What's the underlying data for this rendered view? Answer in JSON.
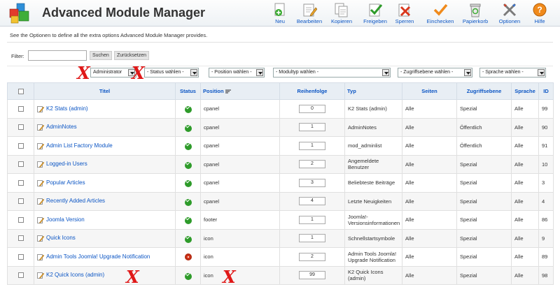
{
  "app": {
    "title": "Advanced Module Manager",
    "description": "See the Optionen to define all the extra options Advanced Module Manager provides."
  },
  "toolbar": [
    {
      "label": "Neu",
      "icon": "new-icon"
    },
    {
      "label": "Bearbeiten",
      "icon": "edit-icon"
    },
    {
      "label": "Kopieren",
      "icon": "copy-icon"
    },
    {
      "label": "Freigeben",
      "icon": "publish-icon"
    },
    {
      "label": "Sperren",
      "icon": "unpublish-icon"
    },
    {
      "label": "Einchecken",
      "icon": "checkin-icon"
    },
    {
      "label": "Papierkorb",
      "icon": "trash-icon"
    },
    {
      "label": "Optionen",
      "icon": "options-icon"
    },
    {
      "label": "Hilfe",
      "icon": "help-icon"
    }
  ],
  "filter": {
    "label": "Filter:",
    "value": "",
    "search_label": "Suchen",
    "reset_label": "Zurücksetzen"
  },
  "selects": {
    "client": "Administrator",
    "status": "- Status wählen -",
    "position": "- Position wählen -",
    "type": "- Modultyp wählen -",
    "access": "- Zugriffsebene wählen -",
    "language": "- Sprache wählen -"
  },
  "table": {
    "headers": {
      "title": "Titel",
      "status": "Status",
      "position": "Position",
      "ordering": "Reihenfolge",
      "type": "Typ",
      "pages": "Seiten",
      "access": "Zugriffsebene",
      "language": "Sprache",
      "id": "ID"
    },
    "rows": [
      {
        "title": "K2 Stats (admin)",
        "published": true,
        "position": "cpanel",
        "ordering": "0",
        "type": "K2 Stats (admin)",
        "pages": "Alle",
        "access": "Spezial",
        "language": "Alle",
        "id": "99"
      },
      {
        "title": "AdminNotes",
        "published": true,
        "position": "cpanel",
        "ordering": "1",
        "type": "AdminNotes",
        "pages": "Alle",
        "access": "Öffentlich",
        "language": "Alle",
        "id": "90"
      },
      {
        "title": "Admin List Factory Module",
        "published": true,
        "position": "cpanel",
        "ordering": "1",
        "type": "mod_adminlist",
        "pages": "Alle",
        "access": "Öffentlich",
        "language": "Alle",
        "id": "91"
      },
      {
        "title": "Logged-in Users",
        "published": true,
        "position": "cpanel",
        "ordering": "2",
        "type": "Angemeldete Benutzer",
        "pages": "Alle",
        "access": "Spezial",
        "language": "Alle",
        "id": "10"
      },
      {
        "title": "Popular Articles",
        "published": true,
        "position": "cpanel",
        "ordering": "3",
        "type": "Beliebteste Beiträge",
        "pages": "Alle",
        "access": "Spezial",
        "language": "Alle",
        "id": "3"
      },
      {
        "title": "Recently Added Articles",
        "published": true,
        "position": "cpanel",
        "ordering": "4",
        "type": "Letzte Neuigkeiten",
        "pages": "Alle",
        "access": "Spezial",
        "language": "Alle",
        "id": "4"
      },
      {
        "title": "Joomla Version",
        "published": true,
        "position": "footer",
        "ordering": "1",
        "type": "Joomla!-Versionsinformationen",
        "pages": "Alle",
        "access": "Spezial",
        "language": "Alle",
        "id": "86"
      },
      {
        "title": "Quick Icons",
        "published": true,
        "position": "icon",
        "ordering": "1",
        "type": "Schnellstartsymbole",
        "pages": "Alle",
        "access": "Spezial",
        "language": "Alle",
        "id": "9"
      },
      {
        "title": "Admin Tools Joomla! Upgrade Notification",
        "published": false,
        "position": "icon",
        "ordering": "2",
        "type": "Admin Tools Joomla! Upgrade Notification",
        "pages": "Alle",
        "access": "Spezial",
        "language": "Alle",
        "id": "89"
      },
      {
        "title": "K2 Quick Icons (admin)",
        "published": true,
        "position": "icon",
        "ordering": "99",
        "type": "K2 Quick Icons (admin)",
        "pages": "Alle",
        "access": "Spezial",
        "language": "Alle",
        "id": "98"
      }
    ]
  },
  "annotations": {
    "mark": "X"
  },
  "colors": {
    "link": "#0b55c4",
    "published": "#2e9b2a",
    "unpublished": "#d9371c",
    "annotation": "#e01818"
  }
}
